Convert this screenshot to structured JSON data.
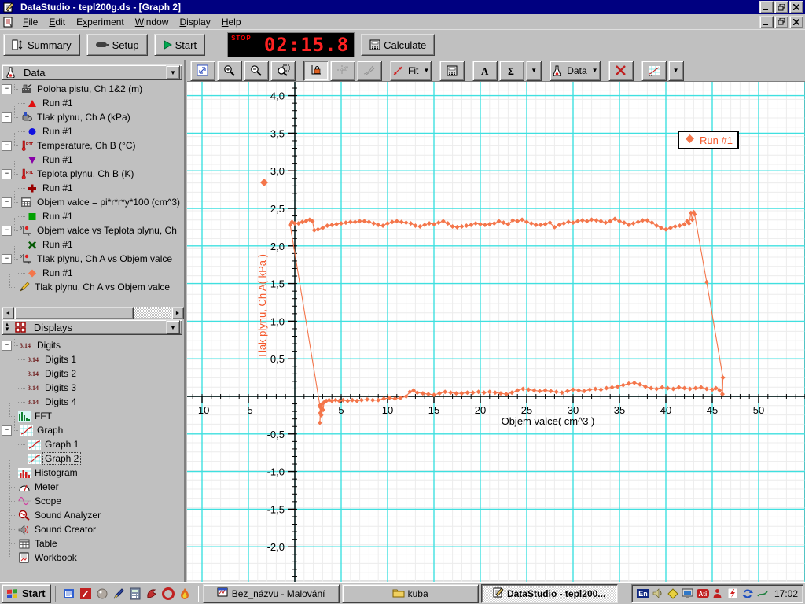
{
  "window": {
    "title": "DataStudio - tepl200g.ds - [Graph 2]"
  },
  "menu": {
    "items": [
      {
        "label": "File",
        "u": 0
      },
      {
        "label": "Edit",
        "u": 0
      },
      {
        "label": "Experiment",
        "u": 1
      },
      {
        "label": "Window",
        "u": 0
      },
      {
        "label": "Display",
        "u": 0
      },
      {
        "label": "Help",
        "u": 0
      }
    ]
  },
  "toolbar": {
    "summary_label": "Summary",
    "setup_label": "Setup",
    "start_label": "Start",
    "calculate_label": "Calculate",
    "timer": {
      "stop_label": "STOP",
      "value": "02:15.8"
    }
  },
  "graph_toolbar": {
    "fit_label": "Fit",
    "data_label": "Data",
    "buttons": [
      {
        "name": "scale-to-fit"
      },
      {
        "name": "zoom-in"
      },
      {
        "name": "zoom-out"
      },
      {
        "name": "zoom-select"
      },
      {
        "name": "axis-lock",
        "pressed": true
      },
      {
        "name": "smart-tool",
        "grayed": true
      },
      {
        "name": "slope-tool",
        "grayed": true
      },
      {
        "name": "fit-menu",
        "label": "Fit",
        "dropdown": true
      },
      {
        "name": "calculator"
      },
      {
        "name": "text-tool"
      },
      {
        "name": "statistics",
        "dropdown": true,
        "split": true
      },
      {
        "name": "data-menu",
        "label": "Data",
        "dropdown": true
      },
      {
        "name": "remove"
      },
      {
        "name": "graph-settings",
        "dropdown": true,
        "split": true
      }
    ]
  },
  "data_panel": {
    "header": "Data",
    "items": [
      {
        "label": "Poloha pistu, Ch 1&2 (m)",
        "icon": "position",
        "expand": true
      },
      {
        "label": "Run #1",
        "child": true,
        "marker": "triangle-up",
        "color": "#e01010"
      },
      {
        "label": "Tlak plynu, Ch A (kPa)",
        "icon": "pressure",
        "expand": true
      },
      {
        "label": "Run #1",
        "child": true,
        "marker": "circle",
        "color": "#1010e0"
      },
      {
        "label": "Temperature, Ch B (°C)",
        "icon": "thermo",
        "expand": true
      },
      {
        "label": "Run #1",
        "child": true,
        "marker": "triangle-down",
        "color": "#8800a8"
      },
      {
        "label": "Teplota plynu, Ch B (K)",
        "icon": "thermo",
        "expand": true
      },
      {
        "label": "Run #1",
        "child": true,
        "marker": "plus",
        "color": "#990000"
      },
      {
        "label": "Objem valce = pi*r*r*y*100 (cm^3)",
        "icon": "calcicon",
        "expand": true
      },
      {
        "label": "Run #1",
        "child": true,
        "marker": "square",
        "color": "#00a000"
      },
      {
        "label": "Objem valce vs Teplota plynu, Ch",
        "icon": "xyicon",
        "expand": true
      },
      {
        "label": "Run #1",
        "child": true,
        "marker": "x-cross",
        "color": "#005800"
      },
      {
        "label": "Tlak plynu, Ch A vs Objem valce",
        "icon": "xyicon",
        "expand": true
      },
      {
        "label": "Run #1",
        "child": true,
        "marker": "diamond",
        "color": "#f4764b"
      },
      {
        "label": "Tlak plynu, Ch A vs Objem valce",
        "icon": "pencil",
        "leaf": true
      }
    ]
  },
  "displays_panel": {
    "header": "Displays",
    "items": [
      {
        "label": "Digits",
        "icon": "digits",
        "expand": true
      },
      {
        "label": "Digits 1",
        "icon": "digits",
        "child": true
      },
      {
        "label": "Digits 2",
        "icon": "digits",
        "child": true
      },
      {
        "label": "Digits 3",
        "icon": "digits",
        "child": true
      },
      {
        "label": "Digits 4",
        "icon": "digits",
        "child": true
      },
      {
        "label": "FFT",
        "icon": "fft"
      },
      {
        "label": "Graph",
        "icon": "graphicon",
        "expand": true
      },
      {
        "label": "Graph 1",
        "icon": "graphicon",
        "child": true
      },
      {
        "label": "Graph 2",
        "icon": "graphicon",
        "child": true,
        "selected": true
      },
      {
        "label": "Histogram",
        "icon": "histicon"
      },
      {
        "label": "Meter",
        "icon": "meter"
      },
      {
        "label": "Scope",
        "icon": "scope"
      },
      {
        "label": "Sound Analyzer",
        "icon": "soundan"
      },
      {
        "label": "Sound Creator",
        "icon": "soundcr"
      },
      {
        "label": "Table",
        "icon": "tableicon"
      },
      {
        "label": "Workbook",
        "icon": "workbook"
      }
    ]
  },
  "chart_data": {
    "type": "scatter",
    "title": "",
    "xlabel": "Objem valce( cm^3 )",
    "ylabel": "Tlak plynu, Ch A( kPa )",
    "legend": {
      "label": "Run #1",
      "position": "top-right"
    },
    "series_color": "#f4764b",
    "grid": {
      "major_color": "#3fe0e0",
      "minor_color": "#ececec"
    },
    "xlim": [
      -11.6,
      55.0
    ],
    "ylim": [
      -2.47,
      4.18
    ],
    "x_ticks": [
      {
        "v": -10,
        "label": "-10"
      },
      {
        "v": -5,
        "label": "-5"
      },
      {
        "v": 5,
        "label": "5"
      },
      {
        "v": 10,
        "label": "10"
      },
      {
        "v": 15,
        "label": "15"
      },
      {
        "v": 20,
        "label": "20"
      },
      {
        "v": 25,
        "label": "25"
      },
      {
        "v": 30,
        "label": "30"
      },
      {
        "v": 35,
        "label": "35"
      },
      {
        "v": 40,
        "label": "40"
      },
      {
        "v": 45,
        "label": "45"
      },
      {
        "v": 50,
        "label": "50"
      }
    ],
    "y_ticks": [
      {
        "v": -2,
        "label": "-2,0"
      },
      {
        "v": -1.5,
        "label": "-1,5"
      },
      {
        "v": -1,
        "label": "-1,0"
      },
      {
        "v": -0.5,
        "label": "-0,5"
      },
      {
        "v": 0.5,
        "label": "0,5"
      },
      {
        "v": 1,
        "label": "1,0"
      },
      {
        "v": 1.5,
        "label": "1,5"
      },
      {
        "v": 2,
        "label": "2,0"
      },
      {
        "v": 2.5,
        "label": "2,5"
      },
      {
        "v": 3,
        "label": "3,0"
      },
      {
        "v": 3.5,
        "label": "3,5"
      },
      {
        "v": 4,
        "label": "4,0"
      }
    ],
    "points": [
      [
        43.1,
        2.42
      ],
      [
        43.0,
        2.45
      ],
      [
        42.85,
        2.35
      ],
      [
        42.7,
        2.44
      ],
      [
        42.5,
        2.3
      ],
      [
        42.3,
        2.33
      ],
      [
        42.0,
        2.29
      ],
      [
        41.5,
        2.27
      ],
      [
        41.0,
        2.26
      ],
      [
        40.5,
        2.24
      ],
      [
        40.0,
        2.22
      ],
      [
        39.5,
        2.24
      ],
      [
        39.0,
        2.27
      ],
      [
        38.5,
        2.31
      ],
      [
        38.0,
        2.34
      ],
      [
        37.5,
        2.34
      ],
      [
        37.0,
        2.32
      ],
      [
        36.5,
        2.3
      ],
      [
        36.0,
        2.28
      ],
      [
        35.5,
        2.31
      ],
      [
        35.0,
        2.33
      ],
      [
        34.5,
        2.36
      ],
      [
        34.0,
        2.33
      ],
      [
        33.5,
        2.31
      ],
      [
        33.0,
        2.33
      ],
      [
        32.5,
        2.34
      ],
      [
        32.0,
        2.35
      ],
      [
        31.5,
        2.33
      ],
      [
        31.0,
        2.34
      ],
      [
        30.5,
        2.33
      ],
      [
        30.0,
        2.31
      ],
      [
        29.5,
        2.32
      ],
      [
        29.0,
        2.3
      ],
      [
        28.5,
        2.28
      ],
      [
        28.0,
        2.25
      ],
      [
        27.5,
        2.31
      ],
      [
        27.0,
        2.29
      ],
      [
        26.5,
        2.28
      ],
      [
        26.0,
        2.28
      ],
      [
        25.5,
        2.3
      ],
      [
        25.0,
        2.32
      ],
      [
        24.5,
        2.35
      ],
      [
        24.0,
        2.33
      ],
      [
        23.5,
        2.34
      ],
      [
        23.0,
        2.29
      ],
      [
        22.5,
        2.31
      ],
      [
        22.0,
        2.33
      ],
      [
        21.5,
        2.3
      ],
      [
        21.0,
        2.29
      ],
      [
        20.5,
        2.28
      ],
      [
        20.0,
        2.29
      ],
      [
        19.5,
        2.3
      ],
      [
        19.0,
        2.28
      ],
      [
        18.5,
        2.27
      ],
      [
        18.0,
        2.26
      ],
      [
        17.5,
        2.25
      ],
      [
        17.0,
        2.26
      ],
      [
        16.5,
        2.3
      ],
      [
        16.0,
        2.33
      ],
      [
        15.5,
        2.31
      ],
      [
        15.0,
        2.29
      ],
      [
        14.5,
        2.3
      ],
      [
        14.0,
        2.28
      ],
      [
        13.5,
        2.26
      ],
      [
        13.0,
        2.27
      ],
      [
        12.5,
        2.3
      ],
      [
        12.0,
        2.31
      ],
      [
        11.5,
        2.32
      ],
      [
        11.0,
        2.33
      ],
      [
        10.5,
        2.32
      ],
      [
        10.0,
        2.3
      ],
      [
        9.5,
        2.27
      ],
      [
        9.0,
        2.28
      ],
      [
        8.5,
        2.3
      ],
      [
        8.0,
        2.32
      ],
      [
        7.5,
        2.33
      ],
      [
        7.0,
        2.33
      ],
      [
        6.5,
        2.32
      ],
      [
        6.0,
        2.32
      ],
      [
        5.5,
        2.31
      ],
      [
        5.0,
        2.3
      ],
      [
        4.5,
        2.29
      ],
      [
        4.0,
        2.28
      ],
      [
        3.5,
        2.27
      ],
      [
        3.0,
        2.24
      ],
      [
        2.5,
        2.22
      ],
      [
        2.1,
        2.21
      ],
      [
        1.9,
        2.33
      ],
      [
        1.6,
        2.35
      ],
      [
        1.2,
        2.33
      ],
      [
        0.8,
        2.32
      ],
      [
        0.4,
        2.3
      ],
      [
        0.0,
        2.3
      ],
      [
        -0.3,
        2.32
      ],
      [
        -0.5,
        2.28
      ],
      [
        2.7,
        -0.12
      ],
      [
        2.75,
        -0.22
      ],
      [
        2.7,
        -0.35
      ],
      [
        2.8,
        -0.15
      ],
      [
        2.85,
        -0.25
      ],
      [
        2.95,
        -0.1
      ],
      [
        3.05,
        -0.18
      ],
      [
        3.15,
        -0.08
      ],
      [
        3.4,
        -0.06
      ],
      [
        3.7,
        -0.05
      ],
      [
        4.0,
        -0.06
      ],
      [
        4.4,
        -0.05
      ],
      [
        4.8,
        -0.06
      ],
      [
        5.2,
        -0.05
      ],
      [
        5.7,
        -0.06
      ],
      [
        6.2,
        -0.05
      ],
      [
        6.7,
        -0.06
      ],
      [
        7.2,
        -0.05
      ],
      [
        7.8,
        -0.04
      ],
      [
        8.4,
        -0.05
      ],
      [
        9.0,
        -0.05
      ],
      [
        9.6,
        -0.03
      ],
      [
        10.2,
        -0.02
      ],
      [
        10.8,
        -0.03
      ],
      [
        11.4,
        -0.02
      ],
      [
        12.0,
        0.0
      ],
      [
        12.4,
        0.06
      ],
      [
        12.8,
        0.08
      ],
      [
        13.2,
        0.05
      ],
      [
        13.8,
        0.04
      ],
      [
        14.4,
        0.03
      ],
      [
        15.0,
        0.02
      ],
      [
        15.6,
        0.04
      ],
      [
        16.2,
        0.06
      ],
      [
        16.8,
        0.05
      ],
      [
        17.4,
        0.04
      ],
      [
        18.0,
        0.04
      ],
      [
        18.6,
        0.05
      ],
      [
        19.2,
        0.05
      ],
      [
        19.8,
        0.06
      ],
      [
        20.4,
        0.05
      ],
      [
        21.0,
        0.06
      ],
      [
        21.6,
        0.05
      ],
      [
        22.2,
        0.04
      ],
      [
        22.8,
        0.03
      ],
      [
        23.4,
        0.05
      ],
      [
        24.0,
        0.08
      ],
      [
        24.6,
        0.1
      ],
      [
        25.2,
        0.09
      ],
      [
        25.8,
        0.08
      ],
      [
        26.4,
        0.07
      ],
      [
        27.0,
        0.08
      ],
      [
        27.6,
        0.07
      ],
      [
        28.2,
        0.06
      ],
      [
        28.8,
        0.05
      ],
      [
        29.4,
        0.07
      ],
      [
        30.0,
        0.09
      ],
      [
        30.6,
        0.08
      ],
      [
        31.2,
        0.07
      ],
      [
        31.8,
        0.09
      ],
      [
        32.4,
        0.1
      ],
      [
        33.0,
        0.09
      ],
      [
        33.6,
        0.11
      ],
      [
        34.2,
        0.12
      ],
      [
        34.8,
        0.13
      ],
      [
        35.4,
        0.15
      ],
      [
        36.0,
        0.17
      ],
      [
        36.6,
        0.18
      ],
      [
        37.2,
        0.16
      ],
      [
        37.8,
        0.13
      ],
      [
        38.4,
        0.11
      ],
      [
        39.0,
        0.1
      ],
      [
        39.6,
        0.12
      ],
      [
        40.2,
        0.11
      ],
      [
        40.8,
        0.1
      ],
      [
        41.4,
        0.12
      ],
      [
        42.0,
        0.11
      ],
      [
        42.6,
        0.1
      ],
      [
        43.2,
        0.11
      ],
      [
        43.8,
        0.12
      ],
      [
        44.4,
        0.1
      ],
      [
        45.0,
        0.09
      ],
      [
        45.4,
        0.11
      ],
      [
        45.8,
        0.08
      ],
      [
        46.1,
        0.03
      ],
      [
        46.15,
        0.25
      ],
      [
        44.4,
        1.52
      ]
    ]
  },
  "taskbar": {
    "start_label": "Start",
    "quicklaunch": [
      "editor-icon",
      "pdf-icon",
      "hand-icon",
      "pen-icon",
      "calculator-icon",
      "dragon-icon",
      "opera-icon",
      "flame-icon"
    ],
    "tasks": [
      {
        "label": "Bez_názvu - Malování",
        "icon": "paint"
      },
      {
        "label": "kuba",
        "icon": "folder"
      },
      {
        "label": "DataStudio - tepl200...",
        "icon": "datastudio",
        "active": true
      }
    ],
    "tray": {
      "lang": "En",
      "clock": "17:02",
      "icons": [
        "volume-icon",
        "scheduler-icon",
        "display-icon",
        "ati-icon",
        "person-icon",
        "lightning-icon",
        "refresh-icon",
        "pen-green-icon"
      ]
    }
  }
}
